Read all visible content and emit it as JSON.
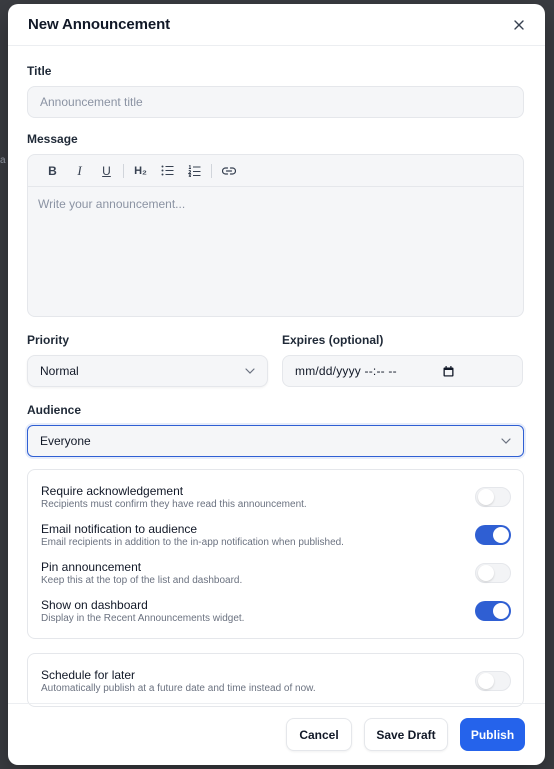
{
  "modal": {
    "title": "New Announcement"
  },
  "form": {
    "title_label": "Title",
    "title_placeholder": "Announcement title",
    "message_label": "Message",
    "message_placeholder": "Write your announcement...",
    "toolbar": {
      "bold": "B",
      "italic": "I",
      "underline": "U",
      "heading": "H₂"
    },
    "priority_label": "Priority",
    "priority_value": "Normal",
    "expires_label": "Expires (optional)",
    "expires_placeholder": "mm/dd/yyyy --:-- --",
    "audience_label": "Audience",
    "audience_value": "Everyone"
  },
  "options": [
    {
      "title": "Require acknowledgement",
      "desc": "Recipients must confirm they have read this announcement.",
      "on": false
    },
    {
      "title": "Email notification to audience",
      "desc": "Email recipients in addition to the in-app notification when published.",
      "on": true
    },
    {
      "title": "Pin announcement",
      "desc": "Keep this at the top of the list and dashboard.",
      "on": false
    },
    {
      "title": "Show on dashboard",
      "desc": "Display in the Recent Announcements widget.",
      "on": true
    }
  ],
  "schedule": {
    "title": "Schedule for later",
    "desc": "Automatically publish at a future date and time instead of now.",
    "on": false
  },
  "footer": {
    "cancel": "Cancel",
    "save_draft": "Save Draft",
    "publish": "Publish"
  },
  "colors": {
    "accent": "#2563eb",
    "toggle_on": "#2f5fd3"
  }
}
